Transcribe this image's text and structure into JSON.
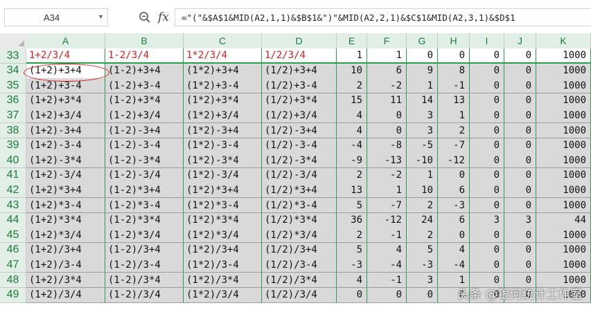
{
  "formula_bar": {
    "name_box": "A34",
    "fx_label": "fx",
    "formula": "=\"(\"&$A$1&MID(A2,1,1)&$B$1&\")\"&MID(A2,2,1)&$C$1&MID(A2,3,1)&$D$1"
  },
  "columns": [
    "A",
    "B",
    "C",
    "D",
    "E",
    "F",
    "G",
    "H",
    "I",
    "J",
    "K"
  ],
  "rows": [
    {
      "n": "33",
      "cells": [
        "1+2/3/4",
        "1-2/3/4",
        "1*2/3/4",
        "1/2/3/4",
        "1",
        "1",
        "0",
        "0",
        "0",
        "0",
        "1000"
      ]
    },
    {
      "n": "34",
      "cells": [
        "(1+2)+3+4",
        "(1-2)+3+4",
        "(1*2)+3+4",
        "(1/2)+3+4",
        "10",
        "6",
        "9",
        "8",
        "0",
        "0",
        "1000"
      ]
    },
    {
      "n": "35",
      "cells": [
        "(1+2)+3-4",
        "(1-2)+3-4",
        "(1*2)+3-4",
        "(1/2)+3-4",
        "2",
        "-2",
        "1",
        "-1",
        "0",
        "0",
        "1000"
      ]
    },
    {
      "n": "36",
      "cells": [
        "(1+2)+3*4",
        "(1-2)+3*4",
        "(1*2)+3*4",
        "(1/2)+3*4",
        "15",
        "11",
        "14",
        "13",
        "0",
        "0",
        "1000"
      ]
    },
    {
      "n": "37",
      "cells": [
        "(1+2)+3/4",
        "(1-2)+3/4",
        "(1*2)+3/4",
        "(1/2)+3/4",
        "4",
        "0",
        "3",
        "1",
        "0",
        "0",
        "1000"
      ]
    },
    {
      "n": "38",
      "cells": [
        "(1+2)-3+4",
        "(1-2)-3+4",
        "(1*2)-3+4",
        "(1/2)-3+4",
        "4",
        "0",
        "3",
        "2",
        "0",
        "0",
        "1000"
      ]
    },
    {
      "n": "39",
      "cells": [
        "(1+2)-3-4",
        "(1-2)-3-4",
        "(1*2)-3-4",
        "(1/2)-3-4",
        "-4",
        "-8",
        "-5",
        "-7",
        "0",
        "0",
        "1000"
      ]
    },
    {
      "n": "40",
      "cells": [
        "(1+2)-3*4",
        "(1-2)-3*4",
        "(1*2)-3*4",
        "(1/2)-3*4",
        "-9",
        "-13",
        "-10",
        "-12",
        "0",
        "0",
        "1000"
      ]
    },
    {
      "n": "41",
      "cells": [
        "(1+2)-3/4",
        "(1-2)-3/4",
        "(1*2)-3/4",
        "(1/2)-3/4",
        "2",
        "-2",
        "1",
        "0",
        "0",
        "0",
        "1000"
      ]
    },
    {
      "n": "42",
      "cells": [
        "(1+2)*3+4",
        "(1-2)*3+4",
        "(1*2)*3+4",
        "(1/2)*3+4",
        "13",
        "1",
        "10",
        "6",
        "0",
        "0",
        "1000"
      ]
    },
    {
      "n": "43",
      "cells": [
        "(1+2)*3-4",
        "(1-2)*3-4",
        "(1*2)*3-4",
        "(1/2)*3-4",
        "5",
        "-7",
        "2",
        "-3",
        "0",
        "0",
        "1000"
      ]
    },
    {
      "n": "44",
      "cells": [
        "(1+2)*3*4",
        "(1-2)*3*4",
        "(1*2)*3*4",
        "(1/2)*3*4",
        "36",
        "-12",
        "24",
        "6",
        "3",
        "3",
        "44"
      ]
    },
    {
      "n": "45",
      "cells": [
        "(1+2)*3/4",
        "(1-2)*3/4",
        "(1*2)*3/4",
        "(1/2)*3/4",
        "2",
        "-1",
        "2",
        "0",
        "0",
        "0",
        "1000"
      ]
    },
    {
      "n": "46",
      "cells": [
        "(1+2)/3+4",
        "(1-2)/3+4",
        "(1*2)/3+4",
        "(1/2)/3+4",
        "5",
        "4",
        "5",
        "4",
        "0",
        "0",
        "1000"
      ]
    },
    {
      "n": "47",
      "cells": [
        "(1+2)/3-4",
        "(1-2)/3-4",
        "(1*2)/3-4",
        "(1/2)/3-4",
        "-3",
        "-4",
        "-3",
        "-4",
        "0",
        "0",
        "1000"
      ]
    },
    {
      "n": "48",
      "cells": [
        "(1+2)/3*4",
        "(1-2)/3*4",
        "(1*2)/3*4",
        "(1/2)/3*4",
        "4",
        "-1",
        "3",
        "1",
        "0",
        "0",
        "1000"
      ]
    },
    {
      "n": "49",
      "cells": [
        "(1+2)/3/4",
        "(1-2)/3/4",
        "(1*2)/3/4",
        "(1/2)/3/4",
        "0",
        "0",
        "0",
        "0",
        "0",
        "0",
        "1000"
      ]
    }
  ],
  "watermark": "头条 @银河统计工作室"
}
